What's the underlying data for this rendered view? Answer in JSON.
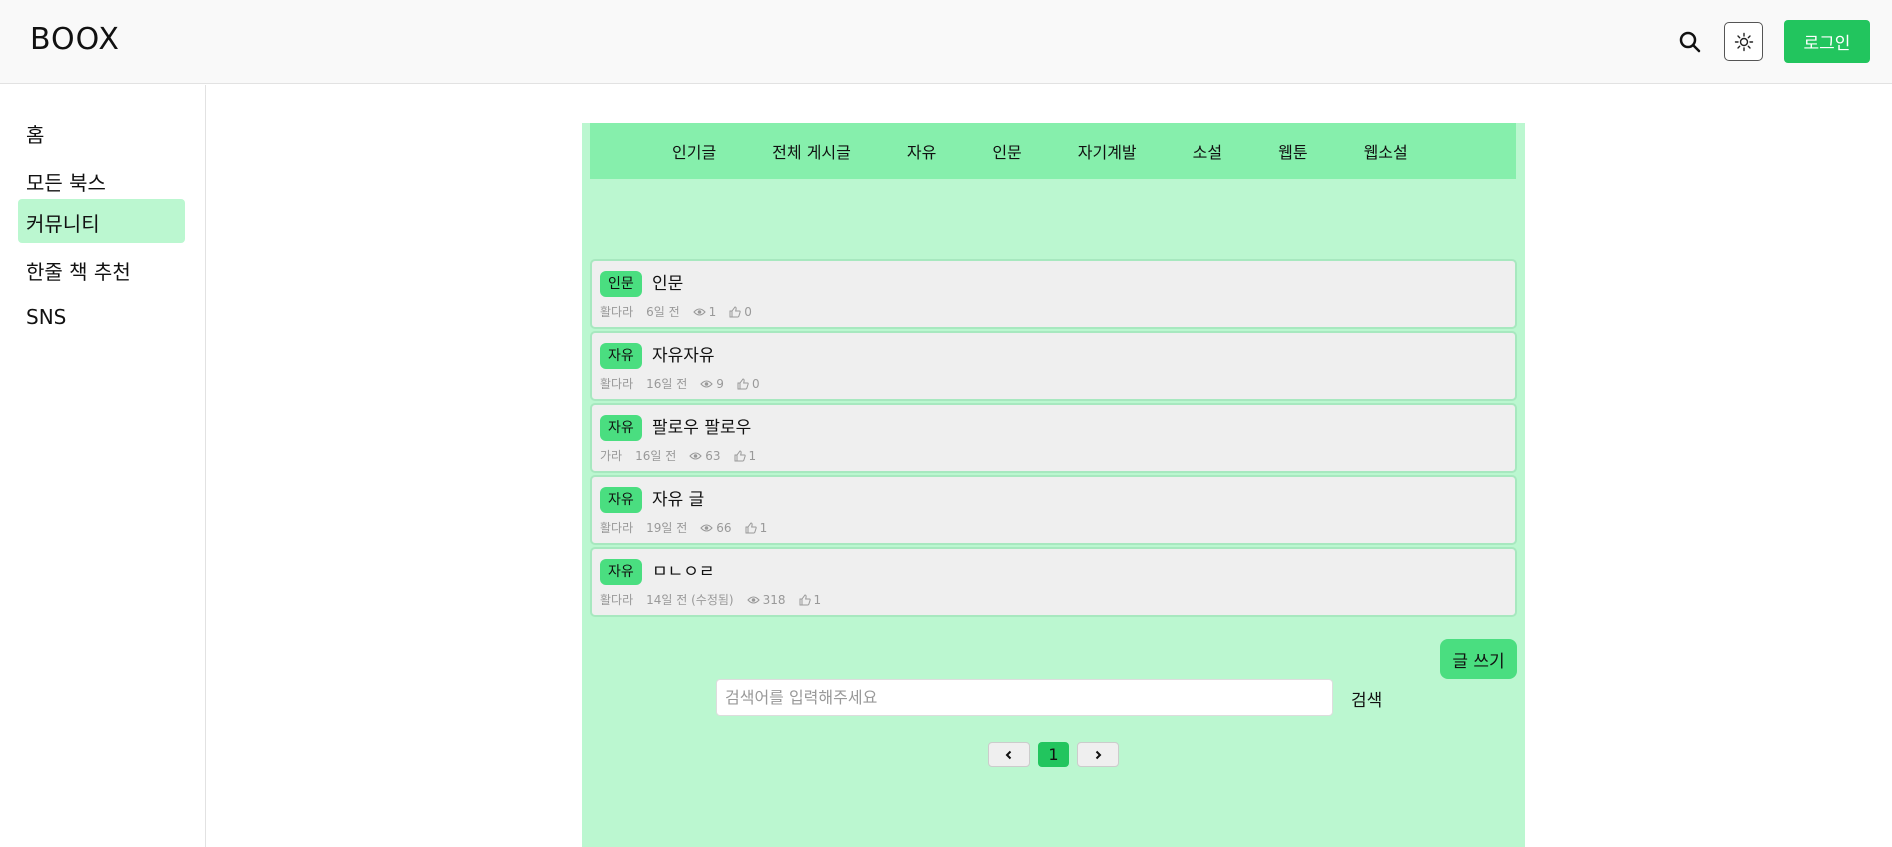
{
  "header": {
    "logo": "BOOX",
    "login_label": "로그인"
  },
  "sidebar": {
    "items": [
      {
        "label": "홈"
      },
      {
        "label": "모든 북스"
      },
      {
        "label": "커뮤니티"
      },
      {
        "label": "한줄 책 추천"
      },
      {
        "label": "SNS"
      }
    ]
  },
  "categories": [
    "인기글",
    "전체 게시글",
    "자유",
    "인문",
    "자기계발",
    "소설",
    "웹툰",
    "웹소설"
  ],
  "posts": [
    {
      "category": "인문",
      "title": "인문",
      "author": "활다라",
      "time": "6일 전",
      "views": "1",
      "likes": "0"
    },
    {
      "category": "자유",
      "title": "자유자유",
      "author": "활다라",
      "time": "16일 전",
      "views": "9",
      "likes": "0"
    },
    {
      "category": "자유",
      "title": "팔로우 팔로우",
      "author": "가라",
      "time": "16일 전",
      "views": "63",
      "likes": "1"
    },
    {
      "category": "자유",
      "title": "자유 글",
      "author": "활다라",
      "time": "19일 전",
      "views": "66",
      "likes": "1"
    },
    {
      "category": "자유",
      "title": "ㅁㄴㅇㄹ",
      "author": "활다라",
      "time": "14일 전 (수정됨)",
      "views": "318",
      "likes": "1"
    }
  ],
  "write_label": "글 쓰기",
  "search": {
    "placeholder": "검색어를 입력해주세요",
    "value": "",
    "button_label": "검색"
  },
  "pagination": {
    "current": "1"
  },
  "colors": {
    "accent": "#22c55e",
    "panel": "#bbf7d0",
    "category_bar": "#86efac",
    "badge": "#4ade80"
  }
}
